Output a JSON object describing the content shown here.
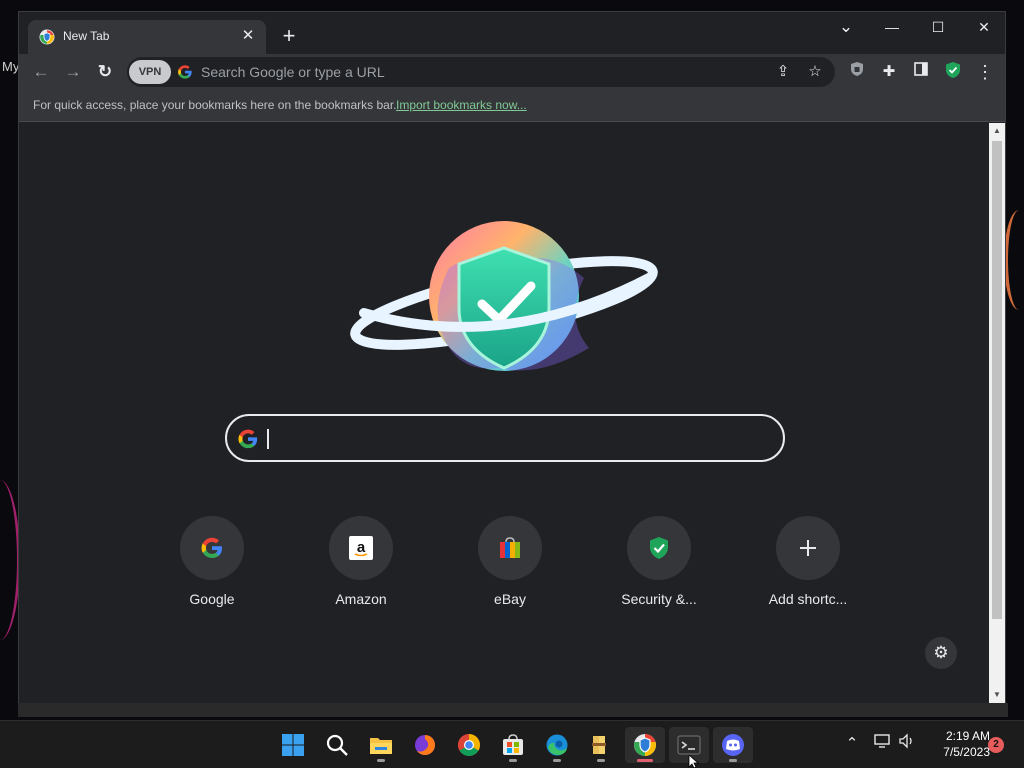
{
  "desktop": {
    "partial_label": "My"
  },
  "browser": {
    "tab": {
      "title": "New Tab",
      "close_label": "✕"
    },
    "new_tab_label": "+",
    "window_controls": {
      "dropdown": "⌄",
      "minimize": "—",
      "maximize": "☐",
      "close": "✕"
    },
    "toolbar": {
      "back": "←",
      "forward": "→",
      "reload": "↻",
      "vpn_label": "VPN",
      "omnibox_placeholder": "Search Google or type a URL",
      "menu": "⋮"
    },
    "bookmarks_bar": {
      "message": "For quick access, place your bookmarks here on the bookmarks bar.",
      "import_link": "Import bookmarks now..."
    },
    "ntp": {
      "shortcuts": [
        {
          "label": "Google",
          "icon": "google-logo"
        },
        {
          "label": "Amazon",
          "icon": "amazon-logo"
        },
        {
          "label": "eBay",
          "icon": "ebay-logo"
        },
        {
          "label": "Security &...",
          "icon": "shield-check-icon"
        },
        {
          "label": "Add shortc...",
          "icon": "plus-icon"
        }
      ],
      "customize_label": "⚙"
    }
  },
  "taskbar": {
    "apps": [
      {
        "name": "start",
        "active": false
      },
      {
        "name": "search",
        "active": false
      },
      {
        "name": "file-explorer",
        "active": false
      },
      {
        "name": "firefox",
        "active": false
      },
      {
        "name": "chrome",
        "active": false
      },
      {
        "name": "microsoft-store",
        "active": false
      },
      {
        "name": "edge",
        "active": false
      },
      {
        "name": "winrar",
        "active": false
      },
      {
        "name": "secure-browser",
        "active": true
      },
      {
        "name": "terminal",
        "active": false
      },
      {
        "name": "discord",
        "active": false
      }
    ],
    "clock": {
      "time": "2:19 AM",
      "date": "7/5/2023"
    },
    "notification_count": "2"
  },
  "colors": {
    "accent_green": "#81c995",
    "chrome_dark": "#202124",
    "toolbar": "#35363a",
    "notification_badge": "#e65c5c"
  }
}
